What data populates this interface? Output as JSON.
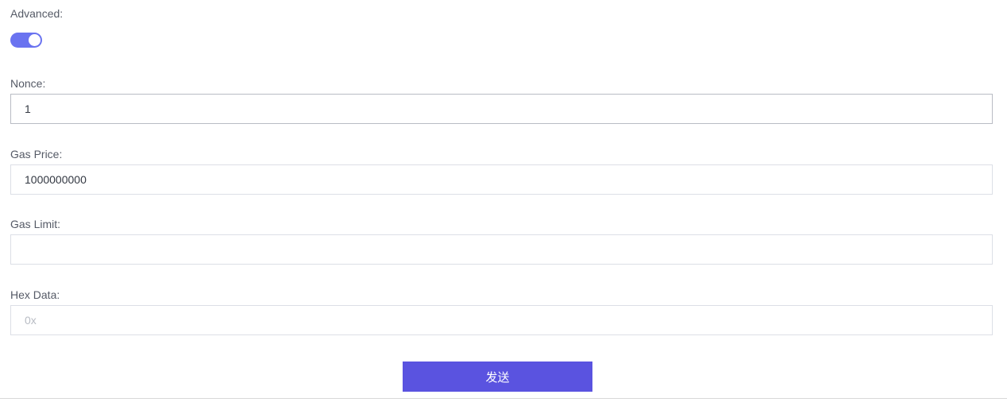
{
  "advanced": {
    "label": "Advanced:",
    "toggle_on": true
  },
  "nonce": {
    "label": "Nonce:",
    "value": "1",
    "placeholder": ""
  },
  "gas_price": {
    "label": "Gas Price:",
    "value": "1000000000",
    "placeholder": ""
  },
  "gas_limit": {
    "label": "Gas Limit:",
    "value": "",
    "placeholder": ""
  },
  "hex_data": {
    "label": "Hex Data:",
    "value": "",
    "placeholder": "0x"
  },
  "send_button": {
    "label": "发送"
  },
  "colors": {
    "accent": "#5a53e0",
    "toggle_on": "#6a73f0",
    "divider": "#d8d8d8"
  }
}
